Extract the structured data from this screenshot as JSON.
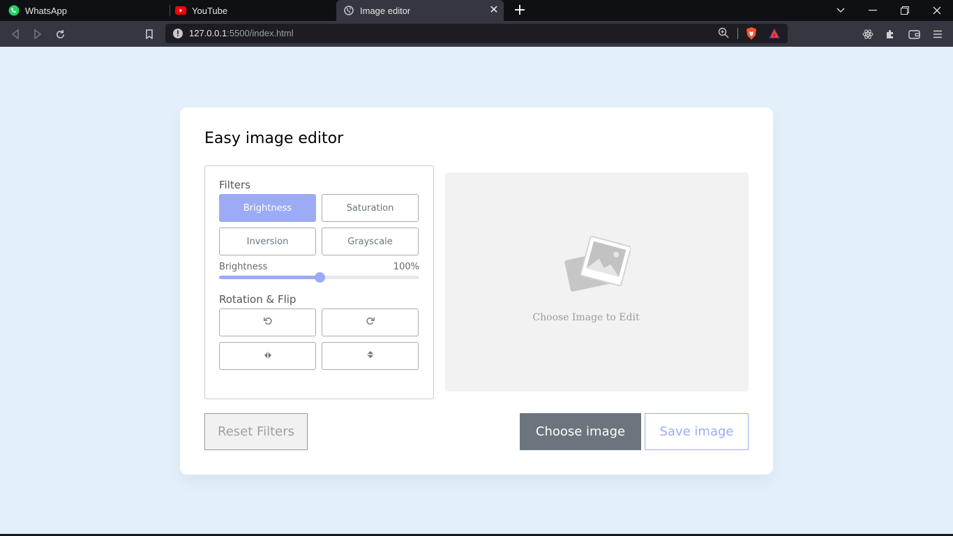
{
  "browser": {
    "tabs": [
      {
        "label": "WhatsApp",
        "icon": "whatsapp-icon"
      },
      {
        "label": "YouTube",
        "icon": "youtube-icon"
      },
      {
        "label": "Image editor",
        "icon": "globe-icon",
        "active": true
      }
    ],
    "url_host": "127.0.0.1",
    "url_rest": ":5500/index.html"
  },
  "editor": {
    "title": "Easy image editor",
    "filters_label": "Filters",
    "filters": [
      "Brightness",
      "Saturation",
      "Inversion",
      "Grayscale"
    ],
    "active_filter": "Brightness",
    "slider_label": "Brightness",
    "slider_value": "100%",
    "slider_fraction": 0.5,
    "rotate_label": "Rotation & Flip",
    "rotate_buttons": [
      "rotate-left-icon",
      "rotate-right-icon",
      "flip-horizontal-icon",
      "flip-vertical-icon"
    ],
    "preview_text": "Choose Image to Edit",
    "reset_label": "Reset Filters",
    "choose_label": "Choose image",
    "save_label": "Save image"
  },
  "colors": {
    "accent": "#9cabf5",
    "background": "#e3f0fb",
    "choose_button": "#6c757d"
  }
}
